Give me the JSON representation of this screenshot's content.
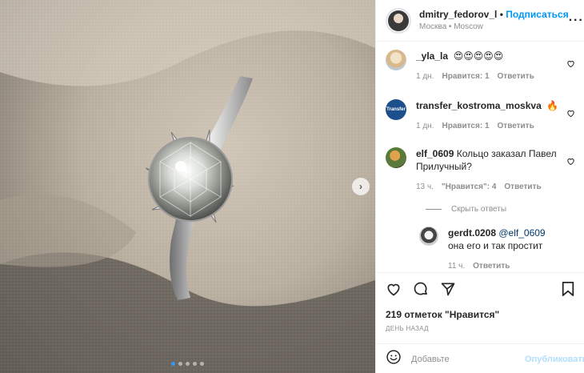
{
  "post": {
    "author": "dmitry_fedorov_l",
    "separator": "•",
    "follow_label": "Подписаться",
    "location": "Москва • Moscow"
  },
  "comments": [
    {
      "user": "_yla_la",
      "text": "😍😍😍😍😍",
      "time": "1 дн.",
      "likes": "Нравится: 1",
      "reply": "Ответить"
    },
    {
      "user": "transfer_kostroma_moskva",
      "text": "🔥",
      "time": "1 дн.",
      "likes": "Нравится: 1",
      "reply": "Ответить"
    },
    {
      "user": "elf_0609",
      "text": "Кольцо заказал Павел Прилучный?",
      "time": "13 ч.",
      "likes": "\"Нравится\": 4",
      "reply": "Ответить"
    }
  ],
  "hide_replies": "Скрыть ответы",
  "reply": {
    "user": "gerdt.0208",
    "mention": "@elf_0609",
    "text": "она его и так простит",
    "time": "11 ч.",
    "reply": "Ответить"
  },
  "likes_text": "219 отметок \"Нравится\"",
  "posted_ago": "ДЕНЬ НАЗАД",
  "comment_input": {
    "placeholder": "Добавьте",
    "value": ""
  },
  "publish_label": "Опубликовать",
  "icons": {
    "photo_next": "chevron-right-icon",
    "more": "more-horizontal-icon",
    "like": "heart-icon",
    "comment": "comment-icon",
    "share": "paper-plane-icon",
    "save": "bookmark-icon",
    "emoji": "emoji-icon"
  },
  "carousel": {
    "count": 5,
    "active": 1
  },
  "colors": {
    "accent": "#0095f6",
    "publish_disabled": "#b2dffc",
    "carousel_active": "#3897f0"
  }
}
